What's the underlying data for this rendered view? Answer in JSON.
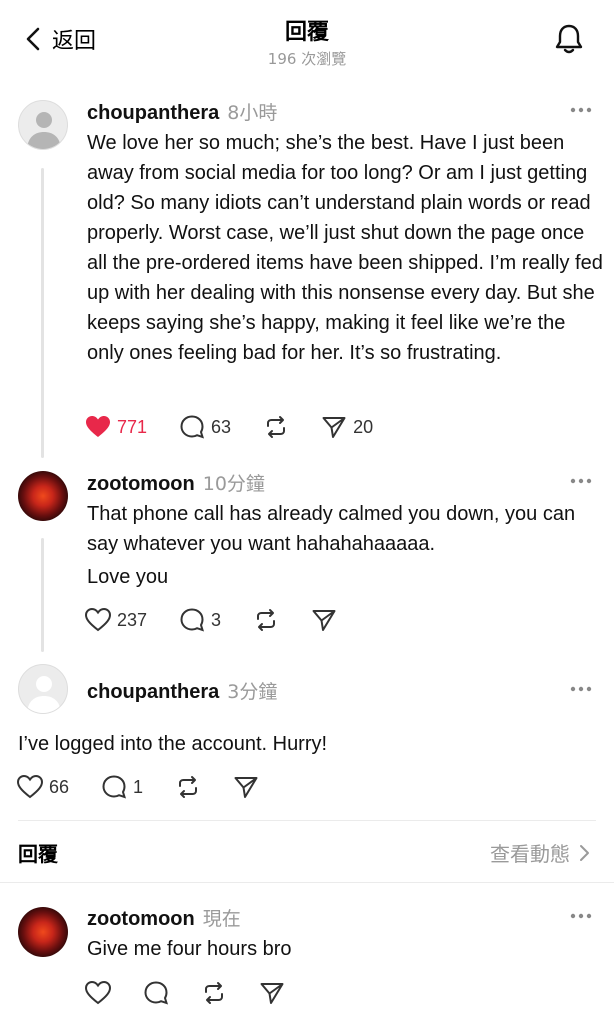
{
  "header": {
    "back_label": "返回",
    "title": "回覆",
    "subtitle": "196 次瀏覽"
  },
  "posts": [
    {
      "username": "choupanthera",
      "time": "8小時",
      "text": "We love her so much; she’s the best. Have I just been away from social media for too long? Or am I just getting old? So many idiots can’t understand plain words or read properly. Worst case, we’ll just shut down the page once all the pre-ordered items have been shipped. I’m really fed up with her dealing with this nonsense every day. But she keeps saying she’s happy, making it feel like we’re the only ones feeling bad for her. It’s so frustrating.",
      "likes": "771",
      "comments": "63",
      "shares": "20",
      "liked": true
    },
    {
      "username": "zootomoon",
      "time": "10分鐘",
      "text": "That phone call has already calmed you down, you can say whatever you want hahahahaaaaa.",
      "text2": "Love you",
      "likes": "237",
      "comments": "3"
    },
    {
      "username": "choupanthera",
      "time": "3分鐘",
      "text": "I’ve logged into the account. Hurry!",
      "likes": "66",
      "comments": "1"
    },
    {
      "username": "zootomoon",
      "time": "現在",
      "text": "Give me four hours bro"
    }
  ],
  "reply_bar": {
    "label": "回覆",
    "view_activity": "查看動態"
  },
  "colors": {
    "like_red": "#e8284a",
    "muted_gray": "#9a9a9a"
  },
  "icons": [
    "chevron-left-icon",
    "bell-icon",
    "more-icon",
    "heart-icon",
    "comment-icon",
    "repost-icon",
    "send-icon",
    "chevron-right-icon"
  ]
}
